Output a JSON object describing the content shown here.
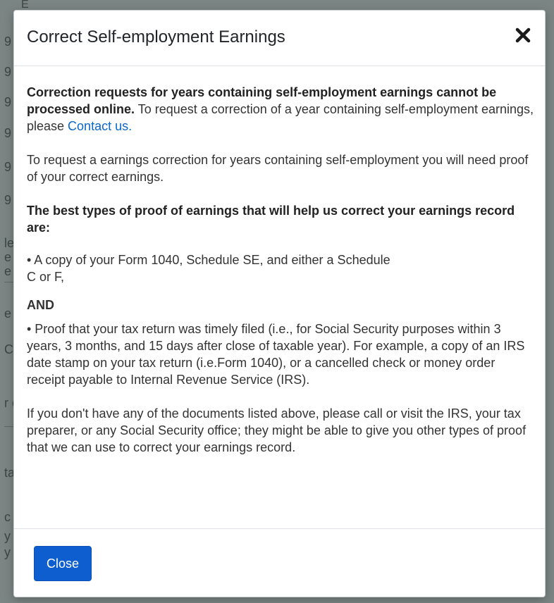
{
  "background": {
    "top_fragment": "E       ...  ...",
    "left_fragments": [
      "9",
      "9",
      "9",
      "9",
      "9",
      "9",
      "le",
      "e",
      "e",
      "e",
      "C",
      "r c",
      "ta",
      "c",
      "y",
      "y"
    ]
  },
  "modal": {
    "title": "Correct Self-employment Earnings",
    "close_icon": "close-x-icon",
    "intro_bold": "Correction requests for years containing self-employment earnings cannot be processed online.",
    "intro_rest": " To request a correction of a year containing self-employment earnings, please ",
    "contact_link": "Contact us.",
    "para2": "To request a earnings correction for years containing self-employment you will need proof of your correct earnings.",
    "proof_heading": "The best types of proof of earnings that will help us correct your earnings record are:",
    "bullet1": "• A copy of your Form 1040, Schedule SE, and either a Schedule C or F,",
    "and_label": "AND",
    "bullet2": "• Proof that your tax return was timely filed (i.e., for Social Security purposes within 3 years, 3 months, and 15 days after close of taxable year). For example, a copy of an IRS date stamp on your tax return (i.e.Form 1040), or a cancelled check or money order receipt payable to Internal Revenue Service (IRS).",
    "final_para": "If you don't have any of the documents listed above, please call or visit the IRS, your tax preparer, or any Social Security office; they might be able to give you other types of proof that we can use to correct your earnings record.",
    "close_button": "Close"
  },
  "colors": {
    "primary": "#0f5ecf",
    "link": "#0b66c8",
    "overlay": "#7b8583"
  }
}
